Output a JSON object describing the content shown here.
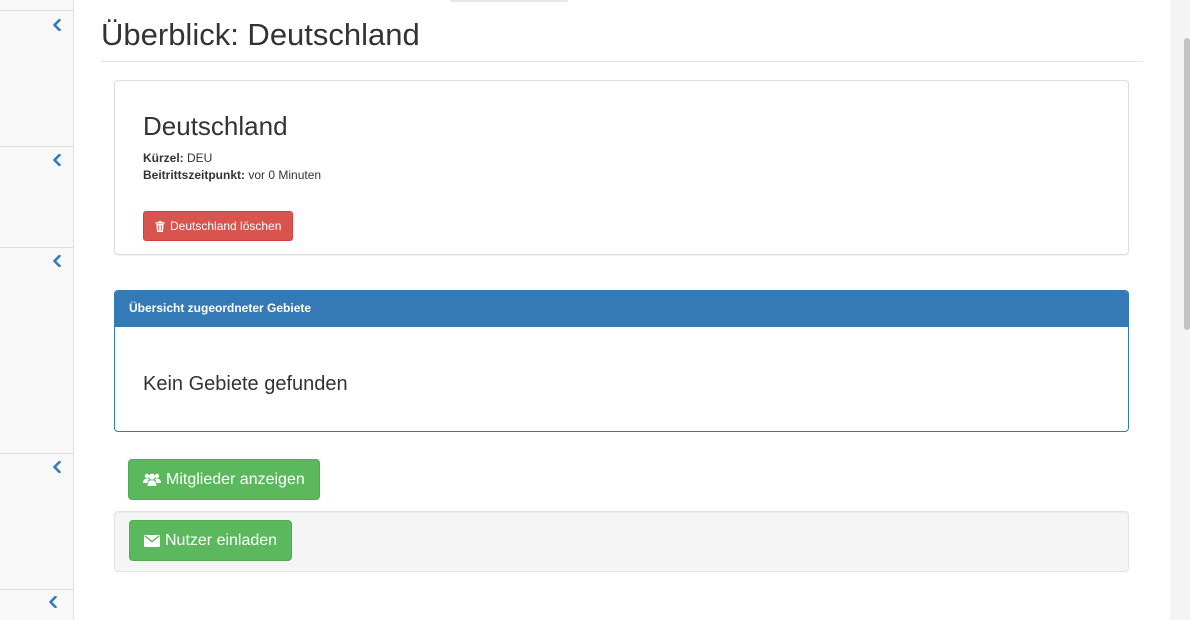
{
  "page": {
    "title": "Überblick: Deutschland"
  },
  "sidebar": {
    "items": [
      {
        "icon": "chevron-left-icon"
      },
      {
        "icon": "chevron-left-icon"
      },
      {
        "icon": "chevron-left-icon"
      },
      {
        "icon": "chevron-left-icon"
      },
      {
        "icon": "chevron-left-icon"
      }
    ]
  },
  "country": {
    "name": "Deutschland",
    "code_label": "Kürzel:",
    "code_value": "DEU",
    "joined_label": "Beitrittszeitpunkt:",
    "joined_value": "vor 0 Minuten",
    "delete_label": "Deutschland löschen",
    "delete_icon": "trash-icon"
  },
  "areas_panel": {
    "heading": "Übersicht zugeordneter Gebiete",
    "empty_message": "Kein Gebiete gefunden"
  },
  "actions": {
    "members_label": "Mitglieder anzeigen",
    "members_icon": "users-icon",
    "invite_label": "Nutzer einladen",
    "invite_icon": "envelope-icon"
  },
  "colors": {
    "primary": "#337ab7",
    "danger": "#d9534f",
    "success": "#5cb85c",
    "link_chevron": "#337ab7"
  }
}
